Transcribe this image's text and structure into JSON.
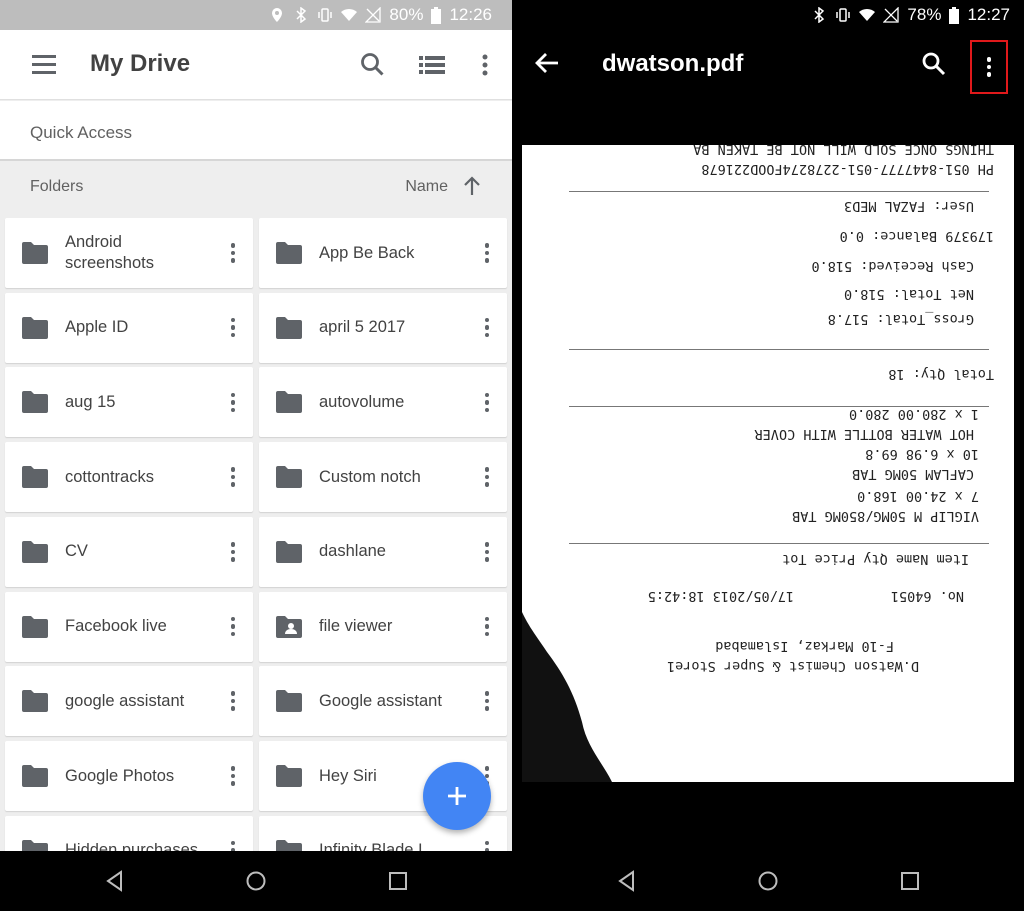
{
  "left": {
    "status": {
      "battery": "80%",
      "time": "12:26"
    },
    "appbar": {
      "title": "My Drive"
    },
    "quick_access": "Quick Access",
    "folders_header": {
      "label": "Folders",
      "sort": "Name"
    },
    "folders": [
      {
        "name": "Android screenshots",
        "shared": false
      },
      {
        "name": "App Be Back",
        "shared": false
      },
      {
        "name": "Apple ID",
        "shared": false
      },
      {
        "name": "april 5 2017",
        "shared": false
      },
      {
        "name": "aug 15",
        "shared": false
      },
      {
        "name": "autovolume",
        "shared": false
      },
      {
        "name": "cottontracks",
        "shared": false
      },
      {
        "name": "Custom notch",
        "shared": false
      },
      {
        "name": "CV",
        "shared": false
      },
      {
        "name": "dashlane",
        "shared": false
      },
      {
        "name": "Facebook live",
        "shared": false
      },
      {
        "name": "file viewer",
        "shared": true
      },
      {
        "name": "google assistant",
        "shared": false
      },
      {
        "name": "Google assistant",
        "shared": false
      },
      {
        "name": "Google Photos",
        "shared": false
      },
      {
        "name": "Hey Siri",
        "shared": false
      },
      {
        "name": "Hidden purchases",
        "shared": false
      },
      {
        "name": "Infinity Blade I",
        "shared": false
      }
    ],
    "fab_label": "+"
  },
  "right": {
    "status": {
      "battery": "78%",
      "time": "12:27"
    },
    "appbar": {
      "title": "dwatson.pdf"
    },
    "receipt_lines": [
      "D.Watson Chemist & Super Store1",
      "F-10 Markaz, Islamabad",
      "No. 64051",
      "17/05/2013 18:42:5",
      "Item Name   Qty   Price   Tot",
      "VIGLIP M 50MG/850MG TAB",
      "7   x   24.00   168.0",
      "CAFLAM 50MG TAB",
      "10   x   6.98   69.8",
      "HOT WATER BOTTLE WITH COVER",
      "1   x   280.00   280.0",
      "Total Qty: 18",
      "Gross_Total:   517.8",
      "Net Total:   518.0",
      "Cash Received:   518.0",
      "179379   Balance:   0.0",
      "User: FAZAL      MED3",
      "PH 051-8447777-051-2278274FOOD221678",
      "THINGS ONCE SOLD WILL NOT BE TAKEN BA"
    ]
  },
  "colors": {
    "accent": "#4285f4",
    "highlight": "#e0191b"
  },
  "icons": [
    "menu-icon",
    "search-icon",
    "list-view-icon",
    "more-vert-icon",
    "arrow-up-icon",
    "folder-icon",
    "shared-folder-icon",
    "add-icon",
    "arrow-back-icon",
    "nav-back-icon",
    "nav-home-icon",
    "nav-recents-icon"
  ]
}
